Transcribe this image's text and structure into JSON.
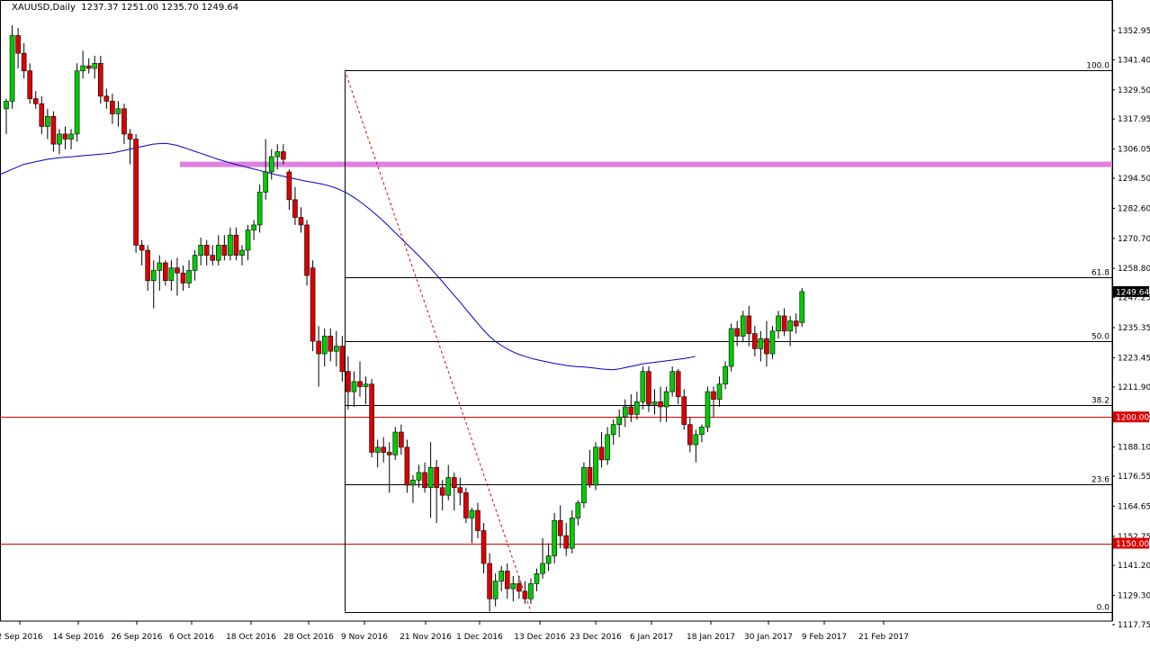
{
  "chart_data": {
    "type": "candlestick",
    "title": "XAUUSD,Daily",
    "ohlc_header": "1237.37 1251.00 1235.70 1249.64",
    "y_ticks": [
      "1352.95",
      "1341.40",
      "1329.50",
      "1317.95",
      "1306.05",
      "1294.50",
      "1282.60",
      "1270.70",
      "1258.80",
      "1247.25",
      "1235.35",
      "1223.45",
      "1211.90",
      "1200.00",
      "1188.10",
      "1176.55",
      "1164.65",
      "1152.75",
      "1141.20",
      "1129.30",
      "1117.75"
    ],
    "x_ticks": [
      "2 Sep 2016",
      "14 Sep 2016",
      "26 Sep 2016",
      "6 Oct 2016",
      "18 Oct 2016",
      "28 Oct 2016",
      "9 Nov 2016",
      "21 Nov 2016",
      "1 Dec 2016",
      "13 Dec 2016",
      "23 Dec 2016",
      "6 Jan 2017",
      "18 Jan 2017",
      "30 Jan 2017",
      "9 Feb 2017",
      "21 Feb 2017"
    ],
    "ylim": [
      1117.75,
      1356.0
    ],
    "current_price_label": "1249.64",
    "horizontal_lines": [
      {
        "label": "1200.00",
        "value": 1200.0,
        "color": "#dd0000"
      },
      {
        "label": "1150.00",
        "value": 1150.0,
        "color": "#dd0000"
      }
    ],
    "resistance_zone": {
      "value": 1300.0,
      "color": "#e080e0"
    },
    "fibonacci": {
      "high": 1337.4,
      "low": 1122.9,
      "levels": [
        {
          "label": "100.0",
          "value": 1337.4
        },
        {
          "label": "61.8",
          "value": 1255.4
        },
        {
          "label": "50.0",
          "value": 1230.1
        },
        {
          "label": "38.2",
          "value": 1204.8
        },
        {
          "label": "23.6",
          "value": 1173.5
        },
        {
          "label": "0.0",
          "value": 1122.9
        }
      ]
    },
    "moving_average": {
      "color": "#0000cc",
      "values": [
        1296,
        1297,
        1298,
        1299,
        1300,
        1300.5,
        1301,
        1301.5,
        1302,
        1302.3,
        1302.6,
        1302.8,
        1303,
        1303.2,
        1303.4,
        1303.6,
        1303.8,
        1304,
        1304.2,
        1304.5,
        1305,
        1305.5,
        1306,
        1306.5,
        1307,
        1307.5,
        1308,
        1308.2,
        1308.3,
        1308,
        1307.5,
        1306.8,
        1306,
        1305.2,
        1304.4,
        1303.6,
        1302.8,
        1302,
        1301.3,
        1300.6,
        1300,
        1299.4,
        1298.8,
        1298.2,
        1297.6,
        1297,
        1296.4,
        1295.8,
        1295.3,
        1294.8,
        1294.3,
        1293.8,
        1293.3,
        1292.9,
        1292.5,
        1292,
        1291.4,
        1290.6,
        1289.6,
        1288.4,
        1287,
        1285.4,
        1283.6,
        1281.7,
        1279.7,
        1277.6,
        1275.4,
        1273.1,
        1270.8,
        1268.5,
        1266.2,
        1263.9,
        1261.5,
        1259,
        1256.4,
        1253.7,
        1251,
        1248.3,
        1245.6,
        1242.8,
        1240,
        1237.2,
        1234.5,
        1232,
        1230,
        1228.4,
        1227,
        1225.8,
        1224.8,
        1224,
        1223.3,
        1222.7,
        1222.2,
        1221.7,
        1221.2,
        1220.8,
        1220.4,
        1220.1,
        1219.9,
        1219.8,
        1219.6,
        1219.3,
        1219,
        1218.8,
        1218.7,
        1219,
        1219.5,
        1220,
        1220.5,
        1221,
        1221.3,
        1221.6,
        1221.9,
        1222.2,
        1222.5,
        1222.8,
        1223.1,
        1223.5,
        1224
      ]
    },
    "candles": [
      {
        "o": 1322,
        "h": 1326,
        "l": 1312,
        "c": 1325
      },
      {
        "o": 1325,
        "h": 1355,
        "l": 1322,
        "c": 1351
      },
      {
        "o": 1351,
        "h": 1354,
        "l": 1338,
        "c": 1344
      },
      {
        "o": 1344,
        "h": 1348,
        "l": 1334,
        "c": 1337
      },
      {
        "o": 1337,
        "h": 1340,
        "l": 1324,
        "c": 1326
      },
      {
        "o": 1326,
        "h": 1329,
        "l": 1322,
        "c": 1324
      },
      {
        "o": 1324,
        "h": 1327,
        "l": 1312,
        "c": 1315
      },
      {
        "o": 1315,
        "h": 1322,
        "l": 1310,
        "c": 1319
      },
      {
        "o": 1319,
        "h": 1321,
        "l": 1305,
        "c": 1308
      },
      {
        "o": 1308,
        "h": 1314,
        "l": 1304,
        "c": 1312
      },
      {
        "o": 1312,
        "h": 1315,
        "l": 1306,
        "c": 1310
      },
      {
        "o": 1310,
        "h": 1314,
        "l": 1306,
        "c": 1312
      },
      {
        "o": 1312,
        "h": 1340,
        "l": 1309,
        "c": 1337
      },
      {
        "o": 1337,
        "h": 1345,
        "l": 1334,
        "c": 1339
      },
      {
        "o": 1339,
        "h": 1342,
        "l": 1336,
        "c": 1338
      },
      {
        "o": 1338,
        "h": 1343,
        "l": 1334,
        "c": 1340
      },
      {
        "o": 1340,
        "h": 1343,
        "l": 1324,
        "c": 1327
      },
      {
        "o": 1327,
        "h": 1330,
        "l": 1322,
        "c": 1325
      },
      {
        "o": 1325,
        "h": 1328,
        "l": 1316,
        "c": 1320
      },
      {
        "o": 1320,
        "h": 1325,
        "l": 1315,
        "c": 1322
      },
      {
        "o": 1322,
        "h": 1324,
        "l": 1308,
        "c": 1312
      },
      {
        "o": 1312,
        "h": 1314,
        "l": 1300,
        "c": 1310
      },
      {
        "o": 1310,
        "h": 1312,
        "l": 1265,
        "c": 1268
      },
      {
        "o": 1268,
        "h": 1270,
        "l": 1260,
        "c": 1266
      },
      {
        "o": 1266,
        "h": 1268,
        "l": 1250,
        "c": 1254
      },
      {
        "o": 1254,
        "h": 1262,
        "l": 1243,
        "c": 1258
      },
      {
        "o": 1258,
        "h": 1264,
        "l": 1250,
        "c": 1261
      },
      {
        "o": 1261,
        "h": 1262,
        "l": 1252,
        "c": 1254
      },
      {
        "o": 1254,
        "h": 1262,
        "l": 1250,
        "c": 1259
      },
      {
        "o": 1259,
        "h": 1263,
        "l": 1248,
        "c": 1257
      },
      {
        "o": 1257,
        "h": 1260,
        "l": 1250,
        "c": 1253
      },
      {
        "o": 1253,
        "h": 1262,
        "l": 1251,
        "c": 1258
      },
      {
        "o": 1258,
        "h": 1266,
        "l": 1254,
        "c": 1264
      },
      {
        "o": 1264,
        "h": 1271,
        "l": 1260,
        "c": 1268
      },
      {
        "o": 1268,
        "h": 1270,
        "l": 1260,
        "c": 1264
      },
      {
        "o": 1264,
        "h": 1268,
        "l": 1260,
        "c": 1262
      },
      {
        "o": 1262,
        "h": 1272,
        "l": 1260,
        "c": 1268
      },
      {
        "o": 1268,
        "h": 1272,
        "l": 1262,
        "c": 1264
      },
      {
        "o": 1264,
        "h": 1275,
        "l": 1262,
        "c": 1272
      },
      {
        "o": 1272,
        "h": 1275,
        "l": 1262,
        "c": 1264
      },
      {
        "o": 1264,
        "h": 1268,
        "l": 1260,
        "c": 1266
      },
      {
        "o": 1266,
        "h": 1276,
        "l": 1262,
        "c": 1274
      },
      {
        "o": 1274,
        "h": 1278,
        "l": 1270,
        "c": 1276
      },
      {
        "o": 1276,
        "h": 1292,
        "l": 1273,
        "c": 1289
      },
      {
        "o": 1289,
        "h": 1310,
        "l": 1286,
        "c": 1297
      },
      {
        "o": 1297,
        "h": 1306,
        "l": 1294,
        "c": 1303
      },
      {
        "o": 1303,
        "h": 1308,
        "l": 1298,
        "c": 1305
      },
      {
        "o": 1305,
        "h": 1308,
        "l": 1300,
        "c": 1302
      },
      {
        "o": 1297,
        "h": 1298,
        "l": 1282,
        "c": 1286
      },
      {
        "o": 1286,
        "h": 1291,
        "l": 1276,
        "c": 1279
      },
      {
        "o": 1279,
        "h": 1283,
        "l": 1273,
        "c": 1276
      },
      {
        "o": 1276,
        "h": 1278,
        "l": 1252,
        "c": 1256
      },
      {
        "o": 1259,
        "h": 1262,
        "l": 1226,
        "c": 1230
      },
      {
        "o": 1230,
        "h": 1236,
        "l": 1212,
        "c": 1225
      },
      {
        "o": 1225,
        "h": 1235,
        "l": 1220,
        "c": 1232
      },
      {
        "o": 1232,
        "h": 1235,
        "l": 1222,
        "c": 1226
      },
      {
        "o": 1226,
        "h": 1234,
        "l": 1220,
        "c": 1228
      },
      {
        "o": 1228,
        "h": 1232,
        "l": 1214,
        "c": 1218
      },
      {
        "o": 1218,
        "h": 1224,
        "l": 1203,
        "c": 1210
      },
      {
        "o": 1210,
        "h": 1218,
        "l": 1204,
        "c": 1214
      },
      {
        "o": 1214,
        "h": 1222,
        "l": 1208,
        "c": 1212
      },
      {
        "o": 1212,
        "h": 1216,
        "l": 1205,
        "c": 1213
      },
      {
        "o": 1213,
        "h": 1215,
        "l": 1184,
        "c": 1186
      },
      {
        "o": 1186,
        "h": 1191,
        "l": 1180,
        "c": 1188
      },
      {
        "o": 1188,
        "h": 1192,
        "l": 1182,
        "c": 1186
      },
      {
        "o": 1186,
        "h": 1190,
        "l": 1170,
        "c": 1185
      },
      {
        "o": 1185,
        "h": 1196,
        "l": 1183,
        "c": 1194
      },
      {
        "o": 1194,
        "h": 1197,
        "l": 1185,
        "c": 1188
      },
      {
        "o": 1188,
        "h": 1191,
        "l": 1170,
        "c": 1173
      },
      {
        "o": 1173,
        "h": 1177,
        "l": 1166,
        "c": 1175
      },
      {
        "o": 1175,
        "h": 1181,
        "l": 1172,
        "c": 1178
      },
      {
        "o": 1178,
        "h": 1182,
        "l": 1170,
        "c": 1172
      },
      {
        "o": 1172,
        "h": 1190,
        "l": 1160,
        "c": 1180
      },
      {
        "o": 1180,
        "h": 1183,
        "l": 1158,
        "c": 1172
      },
      {
        "o": 1172,
        "h": 1175,
        "l": 1163,
        "c": 1169
      },
      {
        "o": 1169,
        "h": 1181,
        "l": 1167,
        "c": 1176
      },
      {
        "o": 1176,
        "h": 1178,
        "l": 1163,
        "c": 1172
      },
      {
        "o": 1172,
        "h": 1176,
        "l": 1165,
        "c": 1170
      },
      {
        "o": 1170,
        "h": 1172,
        "l": 1158,
        "c": 1160
      },
      {
        "o": 1160,
        "h": 1164,
        "l": 1150,
        "c": 1163
      },
      {
        "o": 1163,
        "h": 1166,
        "l": 1152,
        "c": 1155
      },
      {
        "o": 1155,
        "h": 1158,
        "l": 1138,
        "c": 1142
      },
      {
        "o": 1142,
        "h": 1146,
        "l": 1123,
        "c": 1128
      },
      {
        "o": 1128,
        "h": 1138,
        "l": 1125,
        "c": 1135
      },
      {
        "o": 1135,
        "h": 1141,
        "l": 1131,
        "c": 1139
      },
      {
        "o": 1139,
        "h": 1142,
        "l": 1128,
        "c": 1132
      },
      {
        "o": 1132,
        "h": 1137,
        "l": 1127,
        "c": 1134
      },
      {
        "o": 1134,
        "h": 1137,
        "l": 1128,
        "c": 1131
      },
      {
        "o": 1131,
        "h": 1135,
        "l": 1126,
        "c": 1128
      },
      {
        "o": 1128,
        "h": 1136,
        "l": 1126,
        "c": 1134
      },
      {
        "o": 1134,
        "h": 1140,
        "l": 1131,
        "c": 1138
      },
      {
        "o": 1138,
        "h": 1152,
        "l": 1136,
        "c": 1142
      },
      {
        "o": 1142,
        "h": 1150,
        "l": 1139,
        "c": 1145
      },
      {
        "o": 1145,
        "h": 1162,
        "l": 1142,
        "c": 1159
      },
      {
        "o": 1159,
        "h": 1165,
        "l": 1148,
        "c": 1153
      },
      {
        "o": 1153,
        "h": 1158,
        "l": 1145,
        "c": 1148
      },
      {
        "o": 1148,
        "h": 1163,
        "l": 1146,
        "c": 1160
      },
      {
        "o": 1160,
        "h": 1167,
        "l": 1157,
        "c": 1166
      },
      {
        "o": 1166,
        "h": 1182,
        "l": 1164,
        "c": 1180
      },
      {
        "o": 1180,
        "h": 1187,
        "l": 1172,
        "c": 1173
      },
      {
        "o": 1173,
        "h": 1190,
        "l": 1171,
        "c": 1188
      },
      {
        "o": 1188,
        "h": 1194,
        "l": 1180,
        "c": 1183
      },
      {
        "o": 1183,
        "h": 1196,
        "l": 1181,
        "c": 1193
      },
      {
        "o": 1193,
        "h": 1199,
        "l": 1189,
        "c": 1197
      },
      {
        "o": 1197,
        "h": 1203,
        "l": 1192,
        "c": 1200
      },
      {
        "o": 1200,
        "h": 1207,
        "l": 1196,
        "c": 1204
      },
      {
        "o": 1204,
        "h": 1209,
        "l": 1198,
        "c": 1201
      },
      {
        "o": 1201,
        "h": 1210,
        "l": 1199,
        "c": 1206
      },
      {
        "o": 1206,
        "h": 1220,
        "l": 1203,
        "c": 1218
      },
      {
        "o": 1218,
        "h": 1220,
        "l": 1202,
        "c": 1205
      },
      {
        "o": 1205,
        "h": 1211,
        "l": 1201,
        "c": 1206
      },
      {
        "o": 1206,
        "h": 1212,
        "l": 1198,
        "c": 1204
      },
      {
        "o": 1204,
        "h": 1212,
        "l": 1198,
        "c": 1210
      },
      {
        "o": 1210,
        "h": 1220,
        "l": 1208,
        "c": 1218
      },
      {
        "o": 1218,
        "h": 1219,
        "l": 1205,
        "c": 1208
      },
      {
        "o": 1208,
        "h": 1211,
        "l": 1195,
        "c": 1197
      },
      {
        "o": 1197,
        "h": 1200,
        "l": 1186,
        "c": 1189
      },
      {
        "o": 1189,
        "h": 1195,
        "l": 1182,
        "c": 1193
      },
      {
        "o": 1193,
        "h": 1197,
        "l": 1190,
        "c": 1196
      },
      {
        "o": 1196,
        "h": 1212,
        "l": 1194,
        "c": 1210
      },
      {
        "o": 1210,
        "h": 1212,
        "l": 1200,
        "c": 1207
      },
      {
        "o": 1207,
        "h": 1216,
        "l": 1204,
        "c": 1213
      },
      {
        "o": 1213,
        "h": 1222,
        "l": 1211,
        "c": 1220
      },
      {
        "o": 1220,
        "h": 1237,
        "l": 1218,
        "c": 1235
      },
      {
        "o": 1235,
        "h": 1238,
        "l": 1228,
        "c": 1232
      },
      {
        "o": 1232,
        "h": 1242,
        "l": 1230,
        "c": 1240
      },
      {
        "o": 1240,
        "h": 1244,
        "l": 1228,
        "c": 1233
      },
      {
        "o": 1233,
        "h": 1236,
        "l": 1224,
        "c": 1227
      },
      {
        "o": 1227,
        "h": 1234,
        "l": 1222,
        "c": 1231
      },
      {
        "o": 1231,
        "h": 1238,
        "l": 1220,
        "c": 1225
      },
      {
        "o": 1225,
        "h": 1236,
        "l": 1223,
        "c": 1234
      },
      {
        "o": 1234,
        "h": 1242,
        "l": 1231,
        "c": 1240
      },
      {
        "o": 1240,
        "h": 1243,
        "l": 1232,
        "c": 1234
      },
      {
        "o": 1234,
        "h": 1240,
        "l": 1228,
        "c": 1238
      },
      {
        "o": 1238,
        "h": 1241,
        "l": 1233,
        "c": 1236
      },
      {
        "o": 1237.37,
        "h": 1251,
        "l": 1235.7,
        "c": 1249.64
      }
    ]
  }
}
